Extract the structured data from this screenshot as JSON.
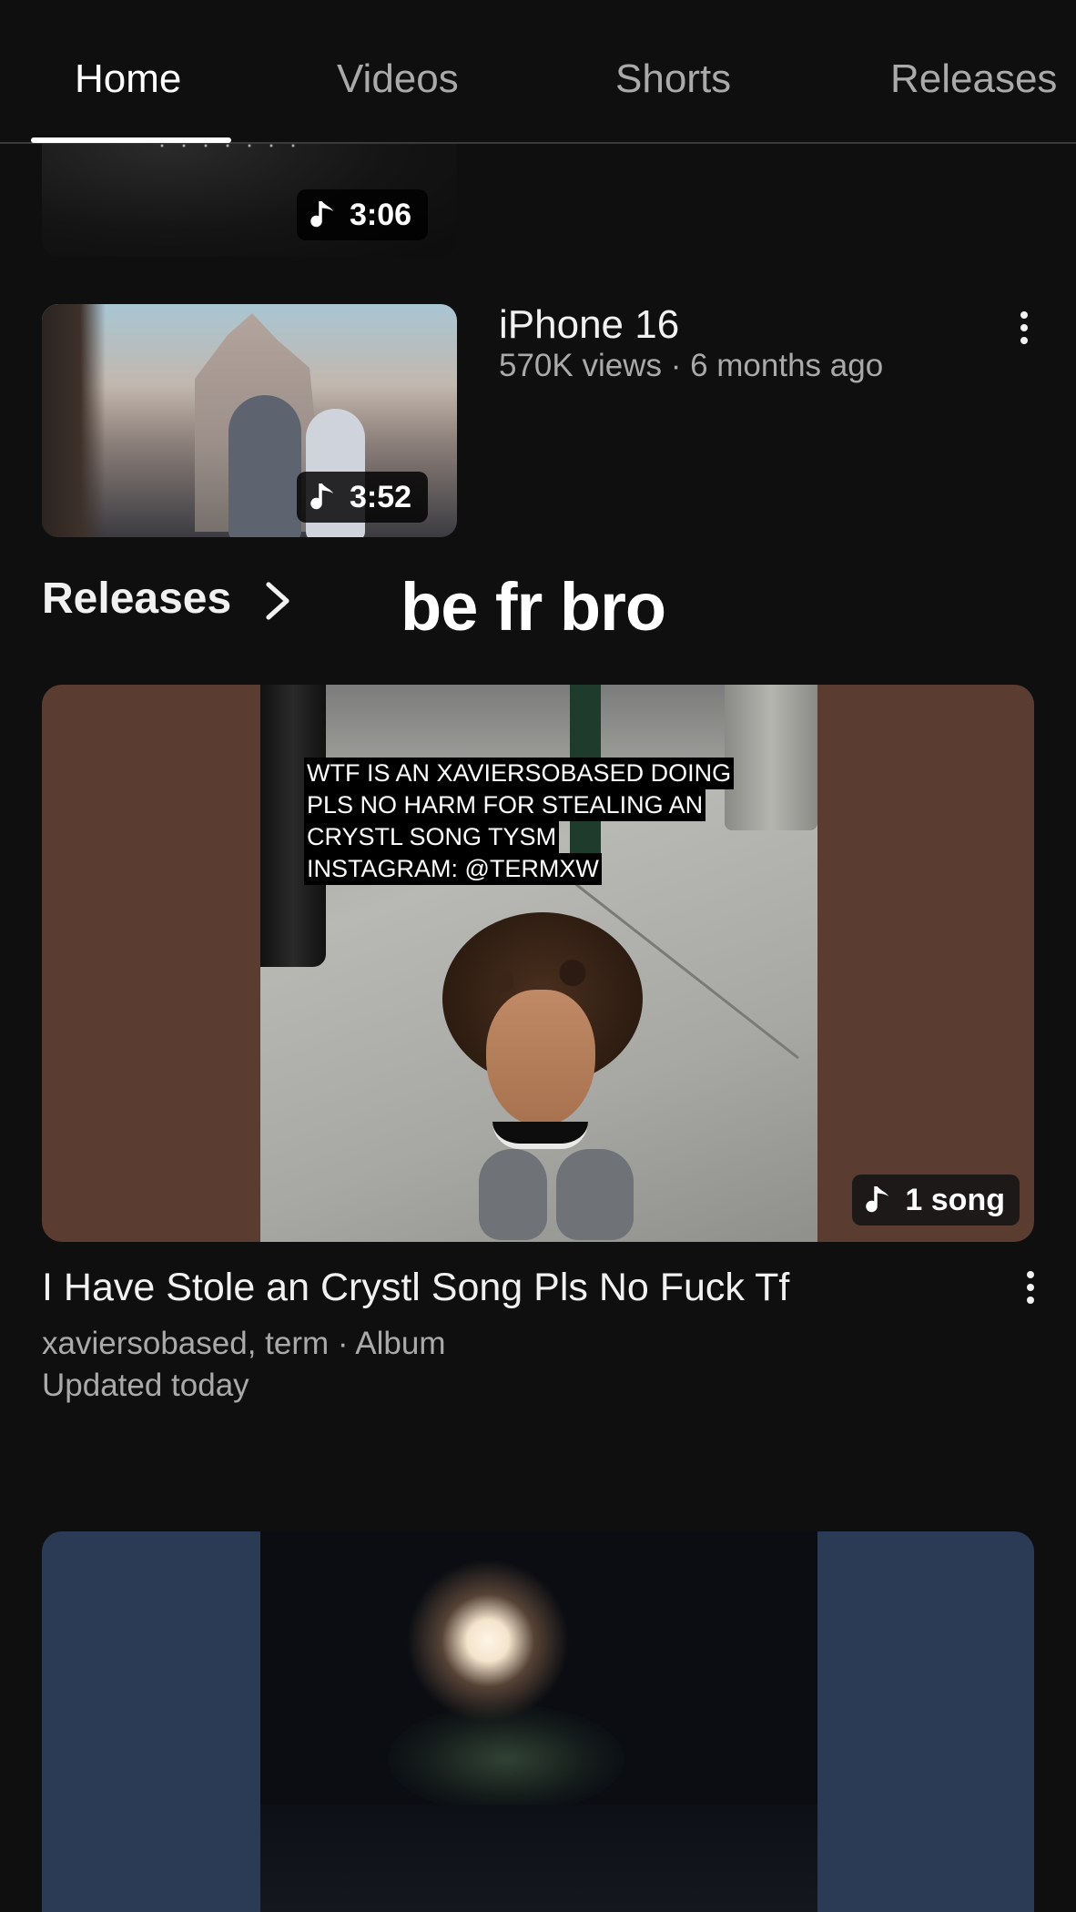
{
  "tabs": [
    {
      "label": "Home",
      "active": true
    },
    {
      "label": "Videos",
      "active": false
    },
    {
      "label": "Shorts",
      "active": false
    },
    {
      "label": "Releases",
      "active": false
    }
  ],
  "previous_video": {
    "duration": "3:06",
    "duration_icon": "music-note-icon"
  },
  "video": {
    "title": "iPhone 16",
    "meta": "570K views · 6 months ago",
    "duration": "3:52",
    "duration_icon": "music-note-icon",
    "menu_icon": "more-vert-icon"
  },
  "section": {
    "title": "Releases",
    "chevron_icon": "chevron-right-icon"
  },
  "caption_overlay": "be fr bro",
  "release_1": {
    "art_text": [
      "WTF IS AN XAVIERSOBASED DOING",
      "PLS NO HARM FOR STEALING AN",
      "CRYSTL SONG TYSM",
      "INSTAGRAM: @TERMXW"
    ],
    "badge": "1 song",
    "badge_icon": "music-note-icon",
    "title": "I Have Stole an Crystl Song Pls No Fuck Tf",
    "meta": "xaviersobased, term · Album",
    "updated": "Updated today",
    "menu_icon": "more-vert-icon",
    "bg_color": "#5a3c30"
  },
  "release_2": {
    "bg_color": "#2b3a55"
  },
  "colors": {
    "background": "#0f0f0f",
    "text_primary": "#f1f1f1",
    "text_secondary": "#aaaaaa"
  }
}
